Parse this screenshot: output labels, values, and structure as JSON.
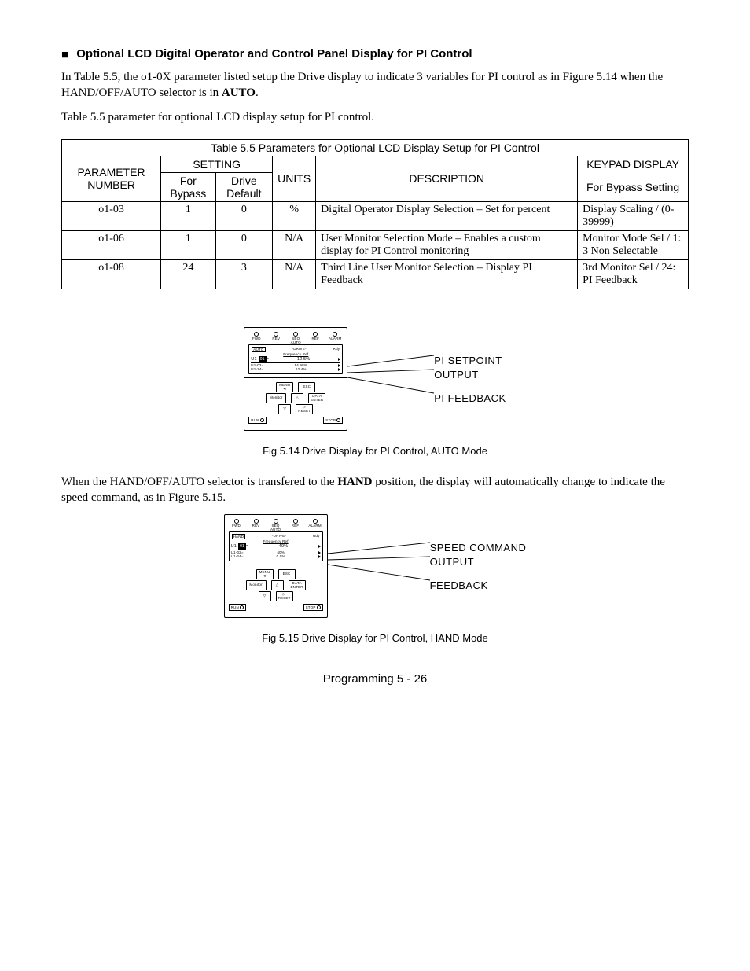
{
  "section": {
    "bullet": "■",
    "title": "Optional LCD Digital Operator and Control Panel Display for PI Control"
  },
  "intro": {
    "p1a": "In Table 5.5, the o1-0X parameter listed setup the Drive display to indicate 3 variables for PI control as in Figure 5.14 when the HAND/OFF/AUTO selector is in ",
    "p1b_bold": "AUTO",
    "p1c": ".",
    "p2": "Table 5.5 parameter for optional LCD display setup for PI control."
  },
  "table": {
    "caption": "Table 5.5   Parameters for Optional LCD Display Setup for PI Control",
    "h": {
      "param": "PARAMETER NUMBER",
      "setting": "SETTING",
      "for_bypass": "For Bypass",
      "drive_default": "Drive Default",
      "units": "UNITS",
      "description": "DESCRIPTION",
      "keypad_display": "KEYPAD DISPLAY",
      "for_bypass_setting": "For Bypass Setting"
    },
    "rows": [
      {
        "param": "o1-03",
        "bypass": "1",
        "default": "0",
        "units": "%",
        "desc": "Digital Operator Display Selection – Set for percent",
        "kd": "Display Scaling / (0-39999)"
      },
      {
        "param": "o1-06",
        "bypass": "1",
        "default": "0",
        "units": "N/A",
        "desc": "User Monitor Selection Mode – Enables a custom display for PI Control monitoring",
        "kd": "Monitor Mode Sel / 1: 3 Non Selectable"
      },
      {
        "param": "o1-08",
        "bypass": "24",
        "default": "3",
        "units": "N/A",
        "desc": "Third Line User Monitor Selection – Display PI Feedback",
        "kd": "3rd Monitor Sel / 24: PI Feedback"
      }
    ]
  },
  "fig1": {
    "caption": "Fig 5.14  Drive Display for PI Control, AUTO Mode",
    "labels": {
      "l1": "PI SETPOINT",
      "l2": "OUTPUT",
      "l3": "PI FEEDBACK"
    },
    "screen": {
      "mode_tag": "AUTO",
      "title_tag": "-DRIVE-",
      "rdy": "Rdy",
      "title": "Frequency Ref",
      "main_l": "U1-",
      "main_box": "01",
      "main_eq": "=",
      "main_v": "12.5%",
      "s1l": "U1-02=",
      "s1v": "54.98%",
      "s2l": "U1-24=",
      "s2v": "12.4%"
    }
  },
  "mid_para": {
    "a": "When the HAND/OFF/AUTO selector is transfered to the ",
    "b_bold": "HAND",
    "c": " position, the display will automatically change to indicate the speed command, as in Figure 5.15."
  },
  "fig2": {
    "caption": "Fig 5.15  Drive Display for PI Control, HAND Mode",
    "labels": {
      "l1": "SPEED COMMAND",
      "l2": "OUTPUT",
      "l3": "FEEDBACK"
    },
    "screen": {
      "mode_tag": "HAND",
      "title_tag": "-DRIVE-",
      "rdy": "Rdy",
      "title": "Frequency Ref",
      "main_l": "U1-",
      "main_box": "01",
      "main_eq": "=",
      "main_v": "40%",
      "s1l": "U1-02=",
      "s1v": "40%",
      "s2l": "U1-24=",
      "s2v": "0.0%"
    }
  },
  "keypad_common": {
    "leds": [
      "FWD",
      "REV",
      "SEQ",
      "REF",
      "ALARM"
    ],
    "auto": "AUTO",
    "menu": "MENU",
    "esc": "ESC",
    "monitor": "Monitor",
    "data": "DATA",
    "enter": "ENTER",
    "reset": "RESET",
    "run": "RUN",
    "stop": "STOP"
  },
  "footer": "Programming  5 - 26"
}
